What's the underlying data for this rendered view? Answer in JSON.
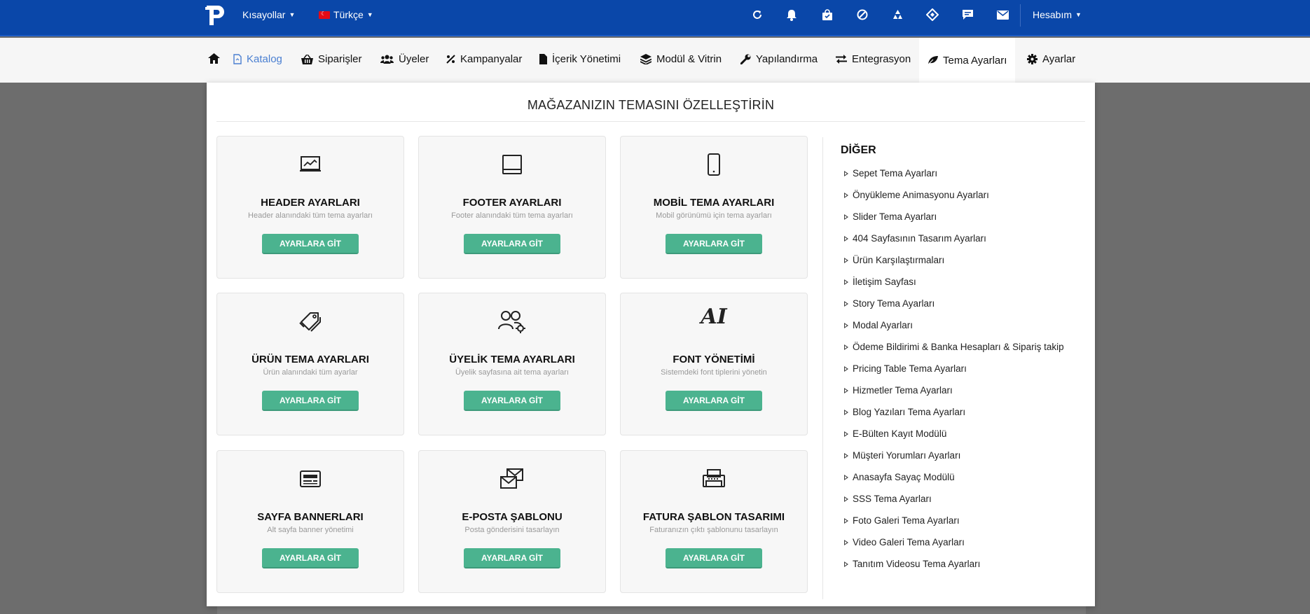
{
  "topbar": {
    "shortcuts_label": "Kısayollar",
    "language_label": "Türkçe",
    "account_label": "Hesabım",
    "icons": [
      "refresh-icon",
      "bell-icon",
      "bag-icon",
      "ban-icon",
      "recycle-icon",
      "ticket-icon",
      "comment-icon",
      "mail-icon"
    ]
  },
  "nav": {
    "items": [
      {
        "label": "Katalog",
        "icon": "file-icon"
      },
      {
        "label": "Siparişler",
        "icon": "basket-icon"
      },
      {
        "label": "Üyeler",
        "icon": "users-icon"
      },
      {
        "label": "Kampanyalar",
        "icon": "percent-icon"
      },
      {
        "label": "İçerik Yönetimi",
        "icon": "document-icon"
      },
      {
        "label": "Modül & Vitrin",
        "icon": "layers-icon"
      },
      {
        "label": "Yapılandırma",
        "icon": "wrench-icon"
      },
      {
        "label": "Entegrasyon",
        "icon": "exchange-icon"
      },
      {
        "label": "Tema Ayarları",
        "icon": "leaf-icon"
      },
      {
        "label": "Ayarlar",
        "icon": "gear-icon"
      }
    ]
  },
  "panel": {
    "title": "MAĞAZANIZIN TEMASINI ÖZELLEŞTİRİN",
    "button_label": "AYARLARA GİT",
    "cards": [
      {
        "title": "HEADER AYARLARI",
        "desc": "Header alanındaki tüm tema ayarları",
        "icon": "monitor-chart-icon"
      },
      {
        "title": "FOOTER AYARLARI",
        "desc": "Footer alanındaki tüm tema ayarları",
        "icon": "footer-layout-icon"
      },
      {
        "title": "MOBİL TEMA AYARLARI",
        "desc": "Mobil görünümü için tema ayarları",
        "icon": "mobile-icon"
      },
      {
        "title": "ÜRÜN TEMA AYARLARI",
        "desc": "Ürün alanındaki tüm ayarlar",
        "icon": "tags-icon"
      },
      {
        "title": "ÜYELİK TEMA AYARLARI",
        "desc": "Üyelik sayfasına ait tema ayarları",
        "icon": "users-gear-icon"
      },
      {
        "title": "FONT YÖNETİMİ",
        "desc": "Sistemdeki font tiplerini yönetin",
        "icon": "font-ai-icon",
        "glyph": "AI"
      },
      {
        "title": "SAYFA BANNERLARI",
        "desc": "Alt sayfa banner yönetimi",
        "icon": "banner-icon"
      },
      {
        "title": "E-POSTA ŞABLONU",
        "desc": "Posta gönderisini tasarlayın",
        "icon": "envelopes-icon"
      },
      {
        "title": "FATURA ŞABLON TASARIMI",
        "desc": "Faturanızın çıktı şablonunu tasarlayın",
        "icon": "printer-icon"
      }
    ]
  },
  "other": {
    "title": "DİĞER",
    "items": [
      "Sepet Tema Ayarları",
      "Önyükleme Animasyonu Ayarları",
      "Slider Tema Ayarları",
      "404 Sayfasının Tasarım Ayarları",
      "Ürün Karşılaştırmaları",
      "İletişim Sayfası",
      "Story Tema Ayarları",
      "Modal Ayarları",
      "Ödeme Bildirimi & Banka Hesapları & Sipariş takip",
      "Pricing Table Tema Ayarları",
      "Hizmetler Tema Ayarları",
      "Blog Yazıları Tema Ayarları",
      "E-Bülten Kayıt Modülü",
      "Müşteri Yorumları Ayarları",
      "Anasayfa Sayaç Modülü",
      "SSS Tema Ayarları",
      "Foto Galeri Tema Ayarları",
      "Video Galeri Tema Ayarları",
      "Tanıtım Videosu Tema Ayarları"
    ]
  },
  "colors": {
    "topbar": "#0a47a9",
    "accent_button": "#4bb38f",
    "active_nav": "#4a7fd1"
  }
}
